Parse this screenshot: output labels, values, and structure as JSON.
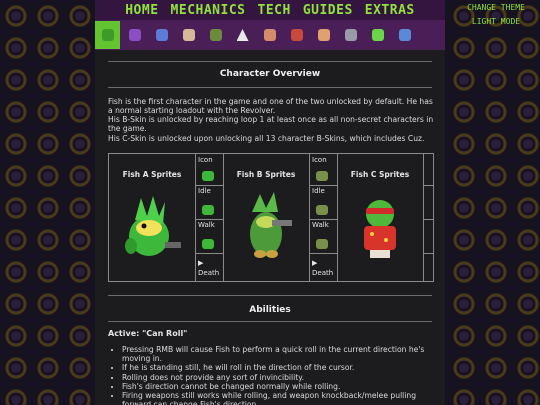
{
  "nav": {
    "items": [
      "HOME",
      "MECHANICS",
      "TECH",
      "GUIDES",
      "EXTRAS"
    ]
  },
  "side_actions": {
    "change_theme": "CHANGE THEME",
    "light_mode": "LIGHT MODE"
  },
  "colors": {
    "accent": "#8fe33a",
    "nav_bg": "#34153f",
    "char_bg": "#4a1f58",
    "selected": "#62c42e"
  },
  "characters": [
    "fish",
    "crystal",
    "eyes",
    "melting",
    "plant",
    "yv",
    "steroids",
    "robot",
    "chicken",
    "rebel",
    "horror",
    "rogue",
    "skeleton"
  ],
  "page": {
    "overview_title": "Character Overview",
    "overview_p1": "Fish is the first character in the game and one of the two unlocked by default. He has a normal starting loadout with the Revolver.",
    "overview_p2": "His B-Skin is unlocked by reaching loop 1 at least once as all non-secret characters in the game.",
    "overview_p3": "His C-Skin is unlocked upon unlocking all 13 character B-Skins, which includes Cuz.",
    "sprites": {
      "fish_a": "Fish A Sprites",
      "fish_b": "Fish B Sprites",
      "fish_c": "Fish C Sprites",
      "icon": "Icon",
      "idle": "Idle",
      "walk": "Walk",
      "death": "Death",
      "play_glyph": "▶"
    },
    "abilities_title": "Abilities",
    "active_label": "Active: \"Can Roll\"",
    "bullets": [
      "Pressing RMB will cause Fish to perform a quick roll in the current direction he's moving in.",
      "If he is standing still, he will roll in the direction of the cursor.",
      "Rolling does not provide any sort of invincibility.",
      "Fish's direction cannot be changed normally while rolling.",
      "Firing weapons still works while rolling, and weapon knockback/melee pulling forward can change Fish's direction."
    ]
  }
}
